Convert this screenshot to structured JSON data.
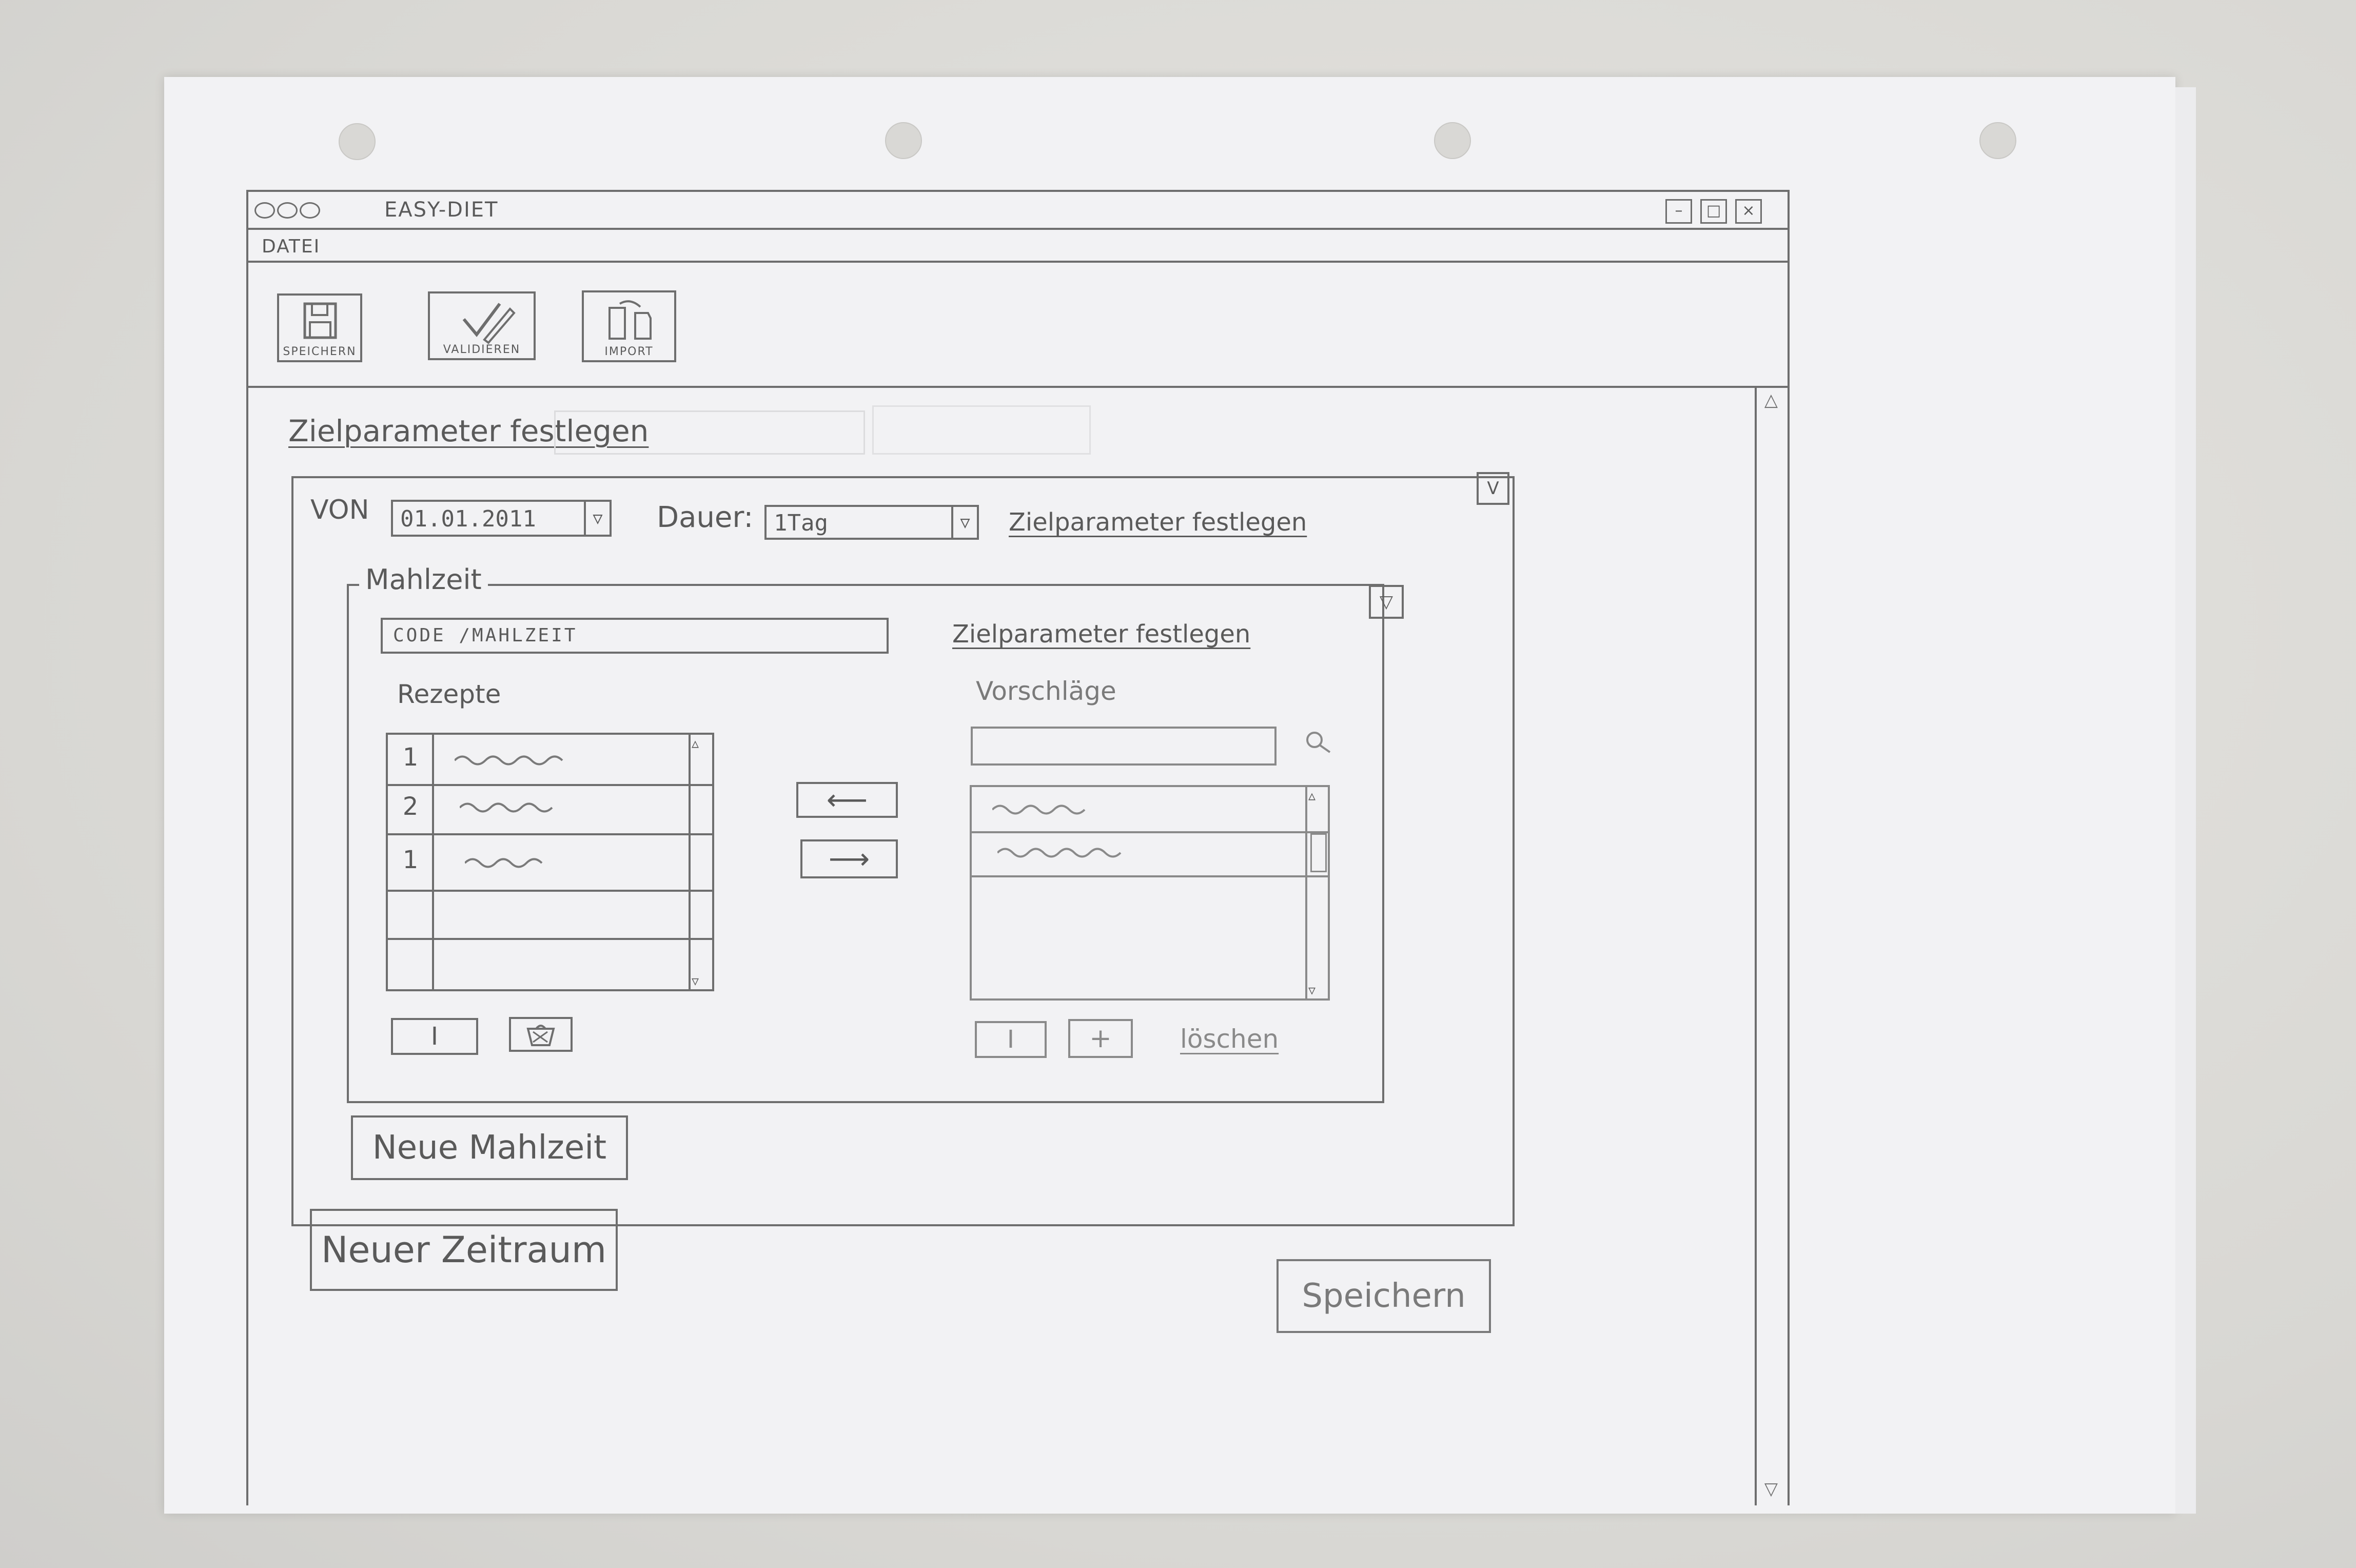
{
  "window": {
    "title": "EASY-DIET",
    "controls": {
      "minimize": "–",
      "maximize": "□",
      "close": "×"
    }
  },
  "menu": {
    "file": "DATEI"
  },
  "toolbar": {
    "save_label": "SPEICHERN",
    "validate_label": "VALIDIEREN",
    "import_label": "IMPORT"
  },
  "main": {
    "section_link": "Zielparameter festlegen",
    "period": {
      "from_label": "VON",
      "from_value": "01.01.2011",
      "duration_label": "Dauer:",
      "duration_value": "1Tag",
      "target_link": "Zielparameter festlegen",
      "collapse_glyph": "V"
    },
    "meal": {
      "legend": "Mahlzeit",
      "code_value": "CODE /MAHLZEIT",
      "target_link": "Zielparameter festlegen",
      "collapse_glyph": "▽",
      "recipes": {
        "label": "Rezepte",
        "rows": [
          {
            "qty": "1"
          },
          {
            "qty": "2"
          },
          {
            "qty": "1"
          },
          {
            "qty": ""
          },
          {
            "qty": ""
          }
        ],
        "edit_button": "I"
      },
      "move_left": "⟵",
      "move_right": "⟶",
      "suggestions": {
        "label": "Vorschläge",
        "search_value": "",
        "add_button": "+",
        "edit_button": "I",
        "delete_link": "löschen"
      }
    },
    "new_meal_button": "Neue Mahlzeit",
    "new_period_button": "Neuer Zeitraum",
    "save_button": "Speichern"
  }
}
